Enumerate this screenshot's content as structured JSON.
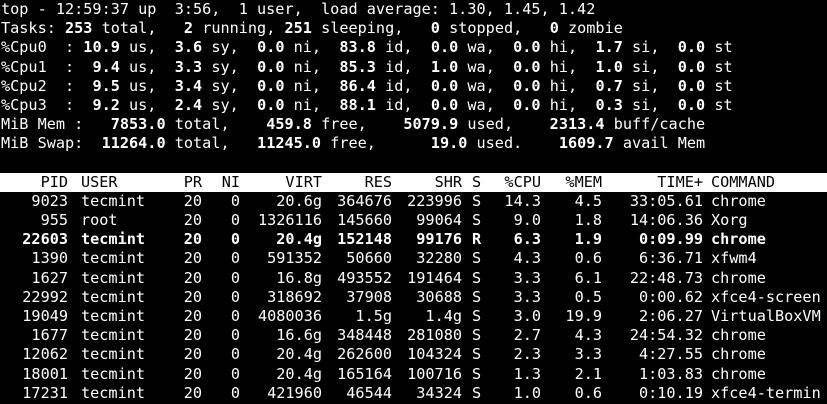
{
  "summary": {
    "top_line": "top - 12:59:37 up  3:56,  1 user,  load average: 1.30, 1.45, 1.42",
    "tasks": {
      "prefix": "Tasks: ",
      "total": "253",
      "total_label": " total,   ",
      "running": "2",
      "running_label": " running, ",
      "sleeping": "251",
      "sleeping_label": " sleeping,   ",
      "stopped": "0",
      "stopped_label": " stopped,   ",
      "zombie": "0",
      "zombie_label": " zombie"
    },
    "cpus": [
      {
        "label": "%Cpu0  : ",
        "us": "10.9",
        "sy": "3.6",
        "ni": "0.0",
        "id": "83.8",
        "wa": "0.0",
        "hi": "0.0",
        "si": "1.7",
        "st": "0.0"
      },
      {
        "label": "%Cpu1  : ",
        "us": " 9.4",
        "sy": "3.3",
        "ni": "0.0",
        "id": "85.3",
        "wa": "1.0",
        "hi": "0.0",
        "si": "1.0",
        "st": "0.0"
      },
      {
        "label": "%Cpu2  : ",
        "us": " 9.5",
        "sy": "3.4",
        "ni": "0.0",
        "id": "86.4",
        "wa": "0.0",
        "hi": "0.0",
        "si": "0.7",
        "st": "0.0"
      },
      {
        "label": "%Cpu3  : ",
        "us": " 9.2",
        "sy": "2.4",
        "ni": "0.0",
        "id": "88.1",
        "wa": "0.0",
        "hi": "0.0",
        "si": "0.3",
        "st": "0.0"
      }
    ],
    "mem": {
      "label": "MiB Mem :   ",
      "total": "7853.0",
      "free": "459.8",
      "used": "5079.9",
      "buff_cache": "2313.4"
    },
    "swap": {
      "label": "MiB Swap:  ",
      "total": "11264.0",
      "free": "11245.0",
      "used": "19.0",
      "avail": "1609.7"
    }
  },
  "table": {
    "headers": {
      "pid": "PID",
      "user": "USER",
      "pr": "PR",
      "ni": "NI",
      "virt": "VIRT",
      "res": "RES",
      "shr": "SHR",
      "s": "S",
      "cpu": "%CPU",
      "mem": "%MEM",
      "time": "TIME+",
      "command": "COMMAND"
    },
    "rows": [
      {
        "pid": "9023",
        "user": "tecmint",
        "pr": "20",
        "ni": "0",
        "virt": "20.6g",
        "res": "364676",
        "shr": "223996",
        "s": "S",
        "cpu": "14.3",
        "mem": "4.5",
        "time": "33:05.61",
        "command": "chrome"
      },
      {
        "pid": "955",
        "user": "root",
        "pr": "20",
        "ni": "0",
        "virt": "1326116",
        "res": "145660",
        "shr": "99064",
        "s": "S",
        "cpu": "9.0",
        "mem": "1.8",
        "time": "14:06.36",
        "command": "Xorg"
      },
      {
        "pid": "22603",
        "user": "tecmint",
        "pr": "20",
        "ni": "0",
        "virt": "20.4g",
        "res": "152148",
        "shr": "99176",
        "s": "R",
        "cpu": "6.3",
        "mem": "1.9",
        "time": "0:09.99",
        "command": "chrome",
        "bold": true
      },
      {
        "pid": "1390",
        "user": "tecmint",
        "pr": "20",
        "ni": "0",
        "virt": "591352",
        "res": "50660",
        "shr": "32280",
        "s": "S",
        "cpu": "4.3",
        "mem": "0.6",
        "time": "6:36.71",
        "command": "xfwm4"
      },
      {
        "pid": "1627",
        "user": "tecmint",
        "pr": "20",
        "ni": "0",
        "virt": "16.8g",
        "res": "493552",
        "shr": "191464",
        "s": "S",
        "cpu": "3.3",
        "mem": "6.1",
        "time": "22:48.73",
        "command": "chrome"
      },
      {
        "pid": "22992",
        "user": "tecmint",
        "pr": "20",
        "ni": "0",
        "virt": "318692",
        "res": "37908",
        "shr": "30688",
        "s": "S",
        "cpu": "3.3",
        "mem": "0.5",
        "time": "0:00.62",
        "command": "xfce4-screen"
      },
      {
        "pid": "19049",
        "user": "tecmint",
        "pr": "20",
        "ni": "0",
        "virt": "4080036",
        "res": "1.5g",
        "shr": "1.4g",
        "s": "S",
        "cpu": "3.0",
        "mem": "19.9",
        "time": "2:06.27",
        "command": "VirtualBoxVM"
      },
      {
        "pid": "1677",
        "user": "tecmint",
        "pr": "20",
        "ni": "0",
        "virt": "16.6g",
        "res": "348448",
        "shr": "281080",
        "s": "S",
        "cpu": "2.7",
        "mem": "4.3",
        "time": "24:54.32",
        "command": "chrome"
      },
      {
        "pid": "12062",
        "user": "tecmint",
        "pr": "20",
        "ni": "0",
        "virt": "20.4g",
        "res": "262600",
        "shr": "104324",
        "s": "S",
        "cpu": "2.3",
        "mem": "3.3",
        "time": "4:27.55",
        "command": "chrome"
      },
      {
        "pid": "18001",
        "user": "tecmint",
        "pr": "20",
        "ni": "0",
        "virt": "20.4g",
        "res": "165164",
        "shr": "100716",
        "s": "S",
        "cpu": "1.3",
        "mem": "2.1",
        "time": "1:03.83",
        "command": "chrome"
      },
      {
        "pid": "17231",
        "user": "tecmint",
        "pr": "20",
        "ni": "0",
        "virt": "421960",
        "res": "46544",
        "shr": "34324",
        "s": "S",
        "cpu": "1.0",
        "mem": "0.6",
        "time": "0:10.19",
        "command": "xfce4-termin"
      }
    ]
  }
}
